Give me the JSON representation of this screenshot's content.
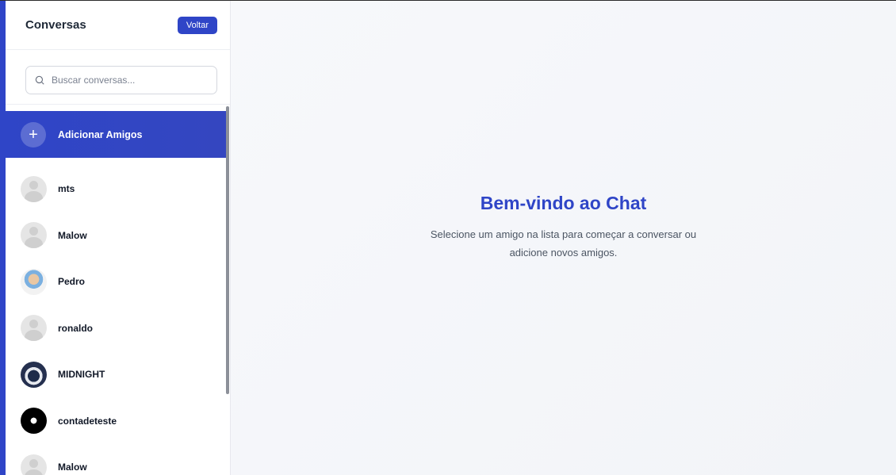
{
  "sidebar": {
    "title": "Conversas",
    "back_label": "Voltar",
    "search": {
      "placeholder": "Buscar conversas..."
    },
    "add_friends_label": "Adicionar Amigos",
    "contacts": [
      {
        "name": "mts",
        "avatar": "default-avatar"
      },
      {
        "name": "Malow",
        "avatar": "default-avatar"
      },
      {
        "name": "Pedro",
        "avatar": "photo-avatar"
      },
      {
        "name": "ronaldo",
        "avatar": "default-avatar"
      },
      {
        "name": "MIDNIGHT",
        "avatar": "photo-avatar"
      },
      {
        "name": "contadeteste",
        "avatar": "photo-avatar"
      },
      {
        "name": "Malow",
        "avatar": "default-avatar"
      }
    ]
  },
  "main": {
    "title": "Bem-vindo ao Chat",
    "subtitle": "Selecione um amigo na lista para começar a conversar ou adicione novos amigos."
  },
  "colors": {
    "accent": "#2f45c7",
    "background": "#f5f6f9"
  }
}
